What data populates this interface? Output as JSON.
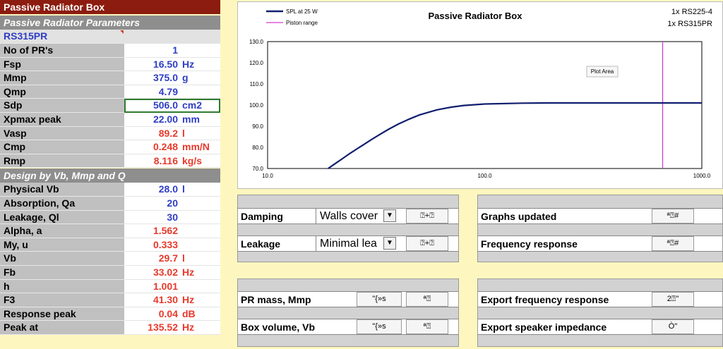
{
  "left_panel": {
    "title": "Passive Radiator Box",
    "section1": "Passive Radiator Parameters",
    "model": "RS315PR",
    "rows1": [
      {
        "label": "No of PR's",
        "value": "1",
        "unit": "",
        "color": "blue"
      },
      {
        "label": "Fsp",
        "value": "16.50",
        "unit": "Hz",
        "color": "blue"
      },
      {
        "label": "Mmp",
        "value": "375.0",
        "unit": "g",
        "color": "blue"
      },
      {
        "label": "Qmp",
        "value": "4.79",
        "unit": "",
        "color": "blue"
      },
      {
        "label": "Sdp",
        "value": "506.0",
        "unit": "cm2",
        "color": "blue"
      },
      {
        "label": "Xpmax peak",
        "value": "22.00",
        "unit": "mm",
        "color": "blue"
      },
      {
        "label": "Vasp",
        "value": "89.2",
        "unit": "l",
        "color": "red"
      },
      {
        "label": "Cmp",
        "value": "0.248",
        "unit": "mm/N",
        "color": "red"
      },
      {
        "label": "Rmp",
        "value": "8.116",
        "unit": "kg/s",
        "color": "red"
      }
    ],
    "section2": "Design by Vb, Mmp and Q",
    "rows2": [
      {
        "label": "Physical Vb",
        "value": "28.0",
        "unit": "l",
        "color": "blue"
      },
      {
        "label": "Absorption, Qa",
        "value": "20",
        "unit": "",
        "color": "blue"
      },
      {
        "label": "Leakage, Ql",
        "value": "30",
        "unit": "",
        "color": "blue"
      },
      {
        "label": "Alpha, a",
        "value": "1.562",
        "unit": "",
        "color": "red"
      },
      {
        "label": "My, u",
        "value": "0.333",
        "unit": "",
        "color": "red"
      },
      {
        "label": "Vb",
        "value": "29.7",
        "unit": "l",
        "color": "red"
      },
      {
        "label": "Fb",
        "value": "33.02",
        "unit": "Hz",
        "color": "red"
      },
      {
        "label": "h",
        "value": "1.001",
        "unit": "",
        "color": "red"
      },
      {
        "label": "F3",
        "value": "41.30",
        "unit": "Hz",
        "color": "red"
      },
      {
        "label": "Response peak",
        "value": "0.04",
        "unit": "dB",
        "color": "red"
      },
      {
        "label": "Peak at",
        "value": "135.52",
        "unit": "Hz",
        "color": "red"
      }
    ]
  },
  "chart_data": {
    "type": "line",
    "title": "Passive Radiator Box",
    "drivers": [
      "1x RS225-4",
      "1x RS315PR"
    ],
    "legend": [
      "SPL at 25 W",
      "Piston range"
    ],
    "x_scale": "log",
    "xlim": [
      10,
      1000
    ],
    "ylim": [
      70,
      130
    ],
    "x_ticks": [
      "10.0",
      "100.0",
      "1000.0"
    ],
    "y_ticks": [
      "70.0",
      "80.0",
      "90.0",
      "100.0",
      "110.0",
      "120.0",
      "130.0"
    ],
    "tooltip": "Plot Area",
    "series": [
      {
        "name": "SPL at 25 W",
        "color": "#101e6e",
        "x": [
          19,
          20,
          22,
          24,
          26,
          28,
          30,
          33,
          36,
          40,
          45,
          50,
          60,
          70,
          80,
          100,
          150,
          200,
          300,
          500,
          1000
        ],
        "y": [
          70,
          71.6,
          74.5,
          77.2,
          79.5,
          81.6,
          83.6,
          86.2,
          88.5,
          91.0,
          93.4,
          95.3,
          97.7,
          99.0,
          99.8,
          100.5,
          100.9,
          101.0,
          101.0,
          101.0,
          101.0
        ]
      },
      {
        "name": "Piston range",
        "color": "#d23bd2",
        "x_line": 660
      }
    ]
  },
  "panels": {
    "damping_label": "Damping",
    "damping_value": "Walls cover",
    "leakage_label": "Leakage",
    "leakage_value": "Minimal lea",
    "dd_btn": "▼",
    "small_btn": "⍰+⍰",
    "graphs_label": "Graphs updated",
    "freq_label": "Frequency response",
    "graphs_btn": "ª⍰#",
    "freq_btn": "ª⍰#",
    "prmass_label": "PR mass, Mmp",
    "boxvol_label": "Box volume, Vb",
    "btn_a": "\"{»s",
    "btn_b": "ª⍰",
    "export_fr_label": "Export frequency response",
    "export_imp_label": "Export speaker impedance",
    "export_fr_btn": "2⍰\"",
    "export_imp_btn": "Ò\""
  },
  "colors": {
    "title_bg": "#8c1c0f",
    "section_bg": "#8e8e8e",
    "label_bg": "#c0c0c0",
    "blue_text": "#2e3ec4",
    "red_text": "#e8392b",
    "background": "#fdf7bf"
  }
}
